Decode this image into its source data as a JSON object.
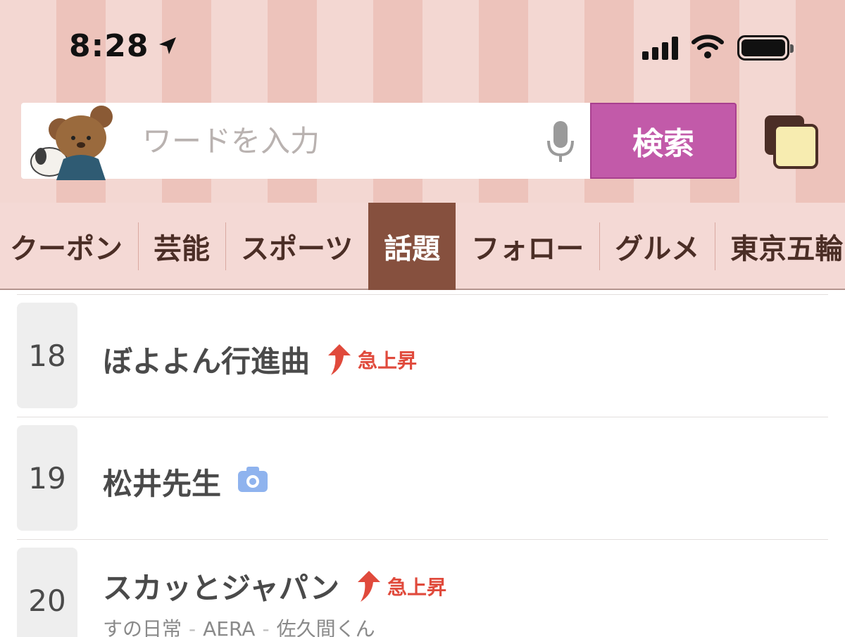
{
  "status_bar": {
    "time": "8:28",
    "location_icon": "location-arrow-icon",
    "signal_icon": "cellular-signal-icon",
    "wifi_icon": "wifi-icon",
    "battery_icon": "battery-icon"
  },
  "search": {
    "placeholder": "ワードを入力",
    "mic_icon": "microphone-icon",
    "button_label": "検索",
    "mascot_icon": "bear-mascot-icon",
    "tabs_icon": "tab-switcher-icon"
  },
  "categories": {
    "tabs": [
      {
        "label": "クーポン"
      },
      {
        "label": "芸能"
      },
      {
        "label": "スポーツ"
      },
      {
        "label": "話題",
        "active": true
      },
      {
        "label": "フォロー"
      },
      {
        "label": "グルメ"
      },
      {
        "label": "東京五輪"
      }
    ],
    "active_color": "#86503e"
  },
  "ranking": {
    "items": [
      {
        "rank": "18",
        "title": "ぼよよん行進曲",
        "badge": "急上昇"
      },
      {
        "rank": "19",
        "title": "松井先生",
        "icon": "camera-icon"
      },
      {
        "rank": "20",
        "title": "スカッとジャパン",
        "badge": "急上昇",
        "related": [
          "すの日常",
          "AERA",
          "佐久間くん"
        ]
      }
    ],
    "badge_color": "#e04a3c"
  }
}
